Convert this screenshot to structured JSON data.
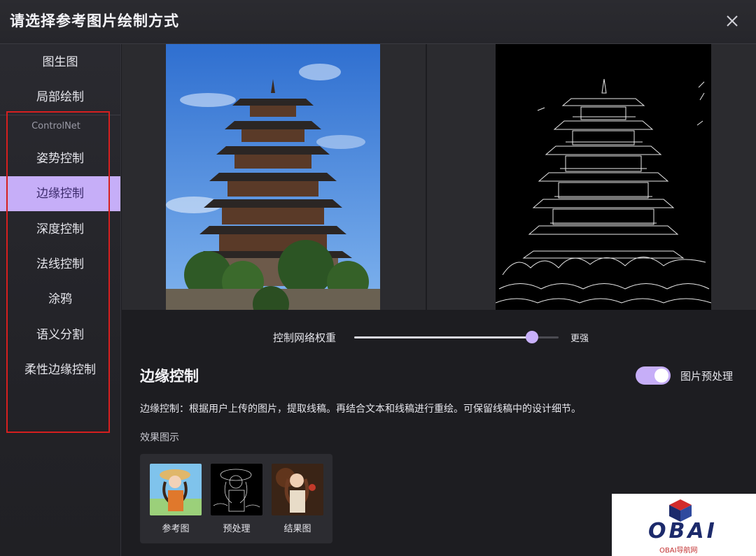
{
  "dialog": {
    "title": "请选择参考图片绘制方式"
  },
  "sidebar": {
    "top_items": [
      {
        "label": "图生图"
      },
      {
        "label": "局部绘制"
      }
    ],
    "section_caption": "ControlNet",
    "items": [
      {
        "label": "姿势控制",
        "active": false
      },
      {
        "label": "边缘控制",
        "active": true
      },
      {
        "label": "深度控制",
        "active": false
      },
      {
        "label": "法线控制",
        "active": false
      },
      {
        "label": "涂鸦",
        "active": false
      },
      {
        "label": "语义分割",
        "active": false
      },
      {
        "label": "柔性边缘控制",
        "active": false
      }
    ]
  },
  "slider": {
    "label": "控制网络权重",
    "end_label": "更强",
    "value_fraction": 0.87
  },
  "section": {
    "title": "边缘控制",
    "toggle_label": "图片预处理",
    "toggle_on": true,
    "description": "边缘控制：根据用户上传的图片，提取线稿。再结合文本和线稿进行重绘。可保留线稿中的设计细节。",
    "effect_label": "效果图示",
    "examples": [
      {
        "caption": "参考图"
      },
      {
        "caption": "预处理"
      },
      {
        "caption": "结果图"
      }
    ]
  },
  "watermark": {
    "brand": "OBAI",
    "sub": "OBAI导航网"
  },
  "colors": {
    "accent": "#c6aef8",
    "highlight_box": "#d61f1f"
  }
}
